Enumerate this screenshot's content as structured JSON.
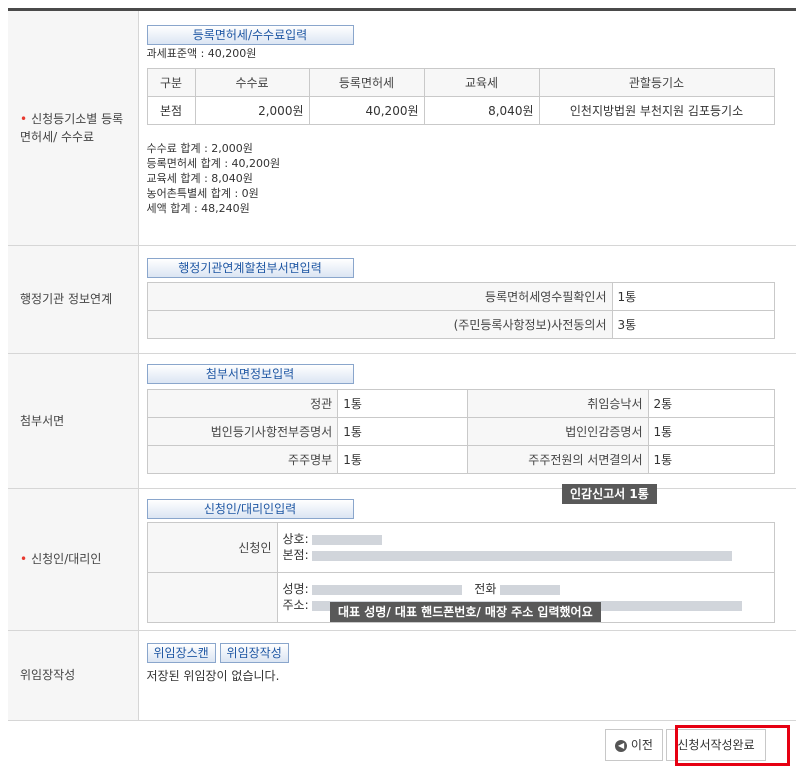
{
  "fee_section": {
    "label": "신청등기소별 등록면허세/ 수수료",
    "button": "등록면허세/수수료입력",
    "tax_base": "과세표준액 : 40,200원",
    "table_headers": [
      "구분",
      "수수료",
      "등록면허세",
      "교육세",
      "관할등기소"
    ],
    "table_rows": [
      [
        "본점",
        "2,000원",
        "40,200원",
        "8,040원",
        "인천지방법원 부천지원 김포등기소"
      ]
    ],
    "summary": [
      "수수료 합계 : 2,000원",
      "등록면허세 합계 : 40,200원",
      "교육세 합계 : 8,040원",
      "농어촌특별세 합계 : 0원",
      "세액 합계 : 48,240원"
    ]
  },
  "admin_section": {
    "label": "행정기관 정보연계",
    "button": "행정기관연계할첨부서면입력",
    "rows": [
      {
        "name": "등록면허세영수필확인서",
        "count": "1통"
      },
      {
        "name": "(주민등록사항정보)사전동의서",
        "count": "3통"
      }
    ]
  },
  "attach_section": {
    "label": "첨부서면",
    "button": "첨부서면정보입력",
    "rows": [
      [
        {
          "name": "정관",
          "count": "1통"
        },
        {
          "name": "취임승낙서",
          "count": "2통"
        }
      ],
      [
        {
          "name": "법인등기사항전부증명서",
          "count": "1통"
        },
        {
          "name": "법인인감증명서",
          "count": "1통"
        }
      ],
      [
        {
          "name": "주주명부",
          "count": "1통"
        },
        {
          "name": "주주전원의 서면결의서",
          "count": "1통"
        }
      ]
    ],
    "annotation": "인감신고서   1통"
  },
  "applicant_section": {
    "label": "신청인/대리인",
    "button": "신청인/대리인입력",
    "applicant_label": "신청인",
    "trade_name": "상호:",
    "head_office": "본점:",
    "person_name": "성명:",
    "phone": "전화",
    "address": "주소:",
    "annotation": "대표 성명/ 대표 핸드폰번호/ 매장 주소  입력했어요"
  },
  "poa_section": {
    "label": "위임장작성",
    "scan_button": "위임장스캔",
    "write_button": "위임장작성",
    "status": "저장된 위임장이 없습니다."
  },
  "footer": {
    "prev_label": "이전",
    "complete_label": "신청서작성완료",
    "highlight_color": "#e60012"
  }
}
